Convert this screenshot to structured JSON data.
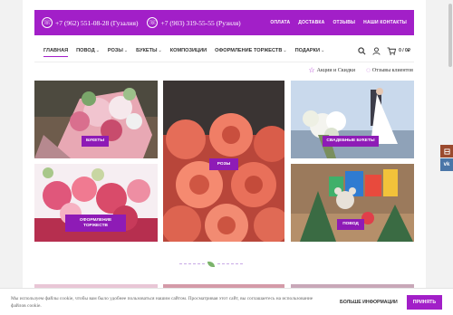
{
  "topbar": {
    "phone1": "+7 (962) 551-08-28 (Гузалия)",
    "phone2": "+7 (903) 319-55-55 (Рузиля)",
    "links": [
      "ОПЛАТА",
      "ДОСТАВКА",
      "ОТЗЫВЫ",
      "НАШИ КОНТАКТЫ"
    ]
  },
  "nav": {
    "items": [
      {
        "label": "ГЛАВНАЯ",
        "active": true
      },
      {
        "label": "ПОВОД",
        "dropdown": true
      },
      {
        "label": "РОЗЫ",
        "dropdown": true
      },
      {
        "label": "БУКЕТЫ",
        "dropdown": true
      },
      {
        "label": "КОМПОЗИЦИИ"
      },
      {
        "label": "ОФОРМЛЕНИЕ ТОРЖЕСТВ",
        "dropdown": true
      },
      {
        "label": "ПОДАРКИ",
        "dropdown": true
      }
    ],
    "cart_count": "0",
    "cart_total": "0 / 0₽"
  },
  "subnav": {
    "promo": "Акции и Скидки",
    "reviews": "Отзывы клиентов"
  },
  "tiles": {
    "bouquets": "БУКЕТЫ",
    "roses": "РОЗЫ",
    "wedding": "СВАДЕБНЫЕ БУКЕТЫ",
    "events": "ОФОРМЛЕНИЕ ТОРЖЕСТВ",
    "occasion": "ПОВОД"
  },
  "cookie": {
    "text": "Мы используем файлы cookie, чтобы вам было удобнее пользоваться нашим сайтом. Просматривая этот сайт, вы соглашаетесь на использование файлов cookie.",
    "more": "БОЛЬШЕ ИНФОРМАЦИИ",
    "accept": "ПРИНЯТЬ"
  },
  "side": {
    "vk": "vk"
  },
  "colors": {
    "brand": "#a21fc8",
    "label_bg": "#8e1bb6",
    "side_top": "#9b4a2e",
    "side_vk": "#4a76a8"
  }
}
